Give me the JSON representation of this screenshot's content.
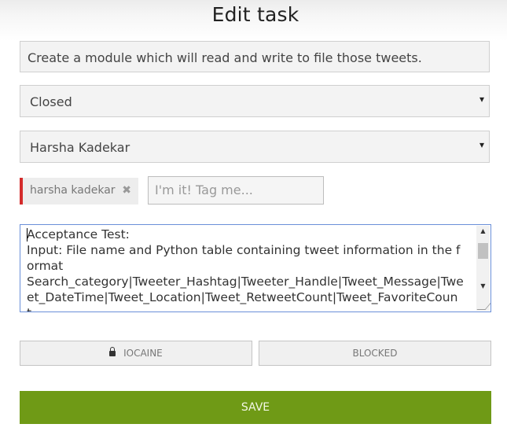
{
  "page": {
    "title": "Edit task"
  },
  "form": {
    "task_title": "Create a module which will read and write to file those tweets.",
    "status": "Closed",
    "assignee": "Harsha Kadekar",
    "caret_glyph": "▾",
    "tag": {
      "label": "harsha kadekar",
      "remove_glyph": "✖"
    },
    "tag_input_placeholder": "I'm it! Tag me...",
    "description": "Acceptance Test:\nInput: File name and Python table containing tweet information in the format\nSearch_category|Tweeter_Hashtag|Tweeter_Handle|Tweet_Message|Tweet_DateTime|Tweet_Location|Tweet_RetweetCount|Tweet_FavoriteCount.\nOutput: Filename.csv file has to be created and tweet information has to",
    "scroll_up_glyph": "▲",
    "scroll_down_glyph": "▼"
  },
  "buttons": {
    "lock_label": "IOCAINE",
    "blocked_label": "BLOCKED",
    "save_label": "SAVE"
  },
  "colors": {
    "save_bg": "#6f9a16",
    "tag_accent": "#d42b2b",
    "focus_border": "#6a8fd8"
  },
  "icons": [
    "lock-icon",
    "close-icon",
    "chevron-down-icon"
  ]
}
